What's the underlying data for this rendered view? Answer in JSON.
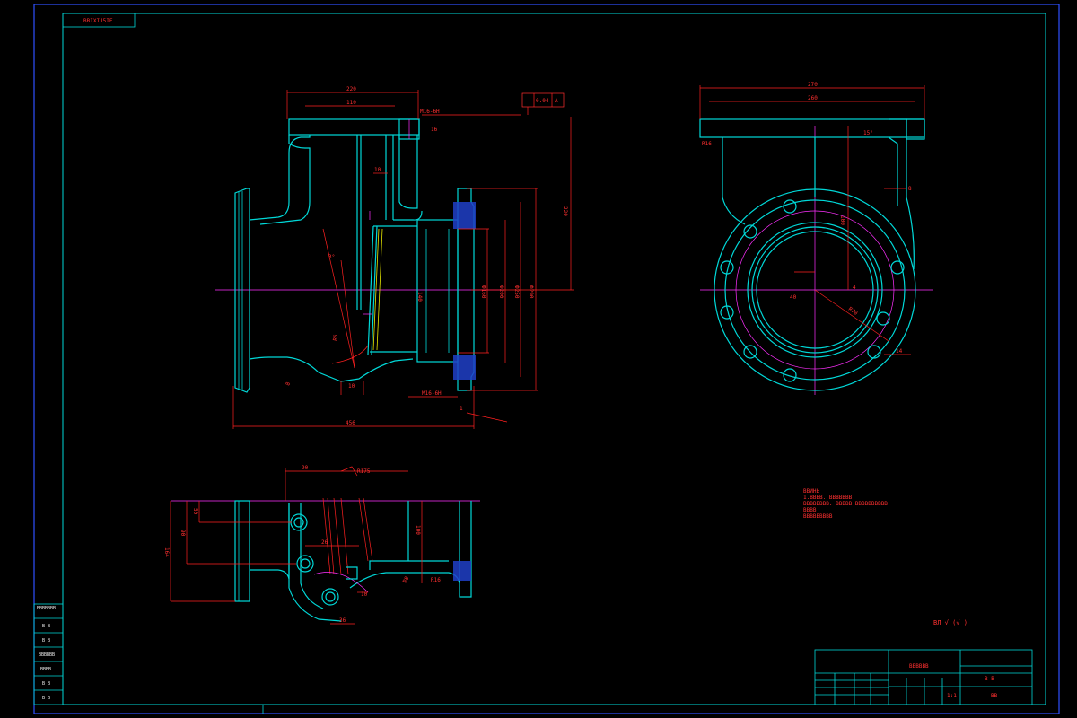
{
  "drawing": {
    "corner_tag": "BBIXIJ5IF",
    "note_lines": [
      "ВВИНЬ",
      "1.ВВВВ. ВВВВВВВ",
      "ВВВВВВВВ. ВВВВВ ВВВВВВВВВВ",
      "ВВВВ",
      "ВВВВВВВВВ"
    ],
    "roughness": "ВЛ  √  (√ )"
  },
  "title_block": {
    "part_name": "ВВВВВВ",
    "label_a": "В В",
    "label_b": "ВВ",
    "scale": "1:1"
  },
  "side_table": [
    "ВВВВВВВ",
    "В В",
    "В В",
    "ВВВВВВ",
    "ВВВВ",
    "В В",
    "В В"
  ],
  "dims_front": {
    "top_width": "220",
    "top_inner": "110",
    "thread_top": "M16-6H",
    "depth": "10",
    "overall_len": "456",
    "height_right": "220",
    "pitch_a": "Ф290",
    "pitch_b": "Ф250",
    "bore_a": "Ф160",
    "bore_b": "Ф200",
    "flange_r": "R6",
    "angle": "3°",
    "gap": "1",
    "thk": "16",
    "thr_bot": "M16-6H",
    "wall": "140",
    "base": "8",
    "small": "10",
    "gdt": "0.04",
    "gdt_ref": "A"
  },
  "dims_side": {
    "top_width": "270",
    "inner": "260",
    "flange": "R16",
    "angle": "15°",
    "height": "100",
    "wall": "8",
    "ref": "4",
    "radius": "R70",
    "offset": "14",
    "center": "40"
  },
  "dims_bottom": {
    "top_a": "90",
    "top_b": "R175",
    "left_a": "50",
    "left_b": "90",
    "left_c": "164",
    "mid": "26",
    "bottom": "36",
    "right_a": "100",
    "right_b": "R16",
    "r_small": "R8",
    "side": "10"
  }
}
